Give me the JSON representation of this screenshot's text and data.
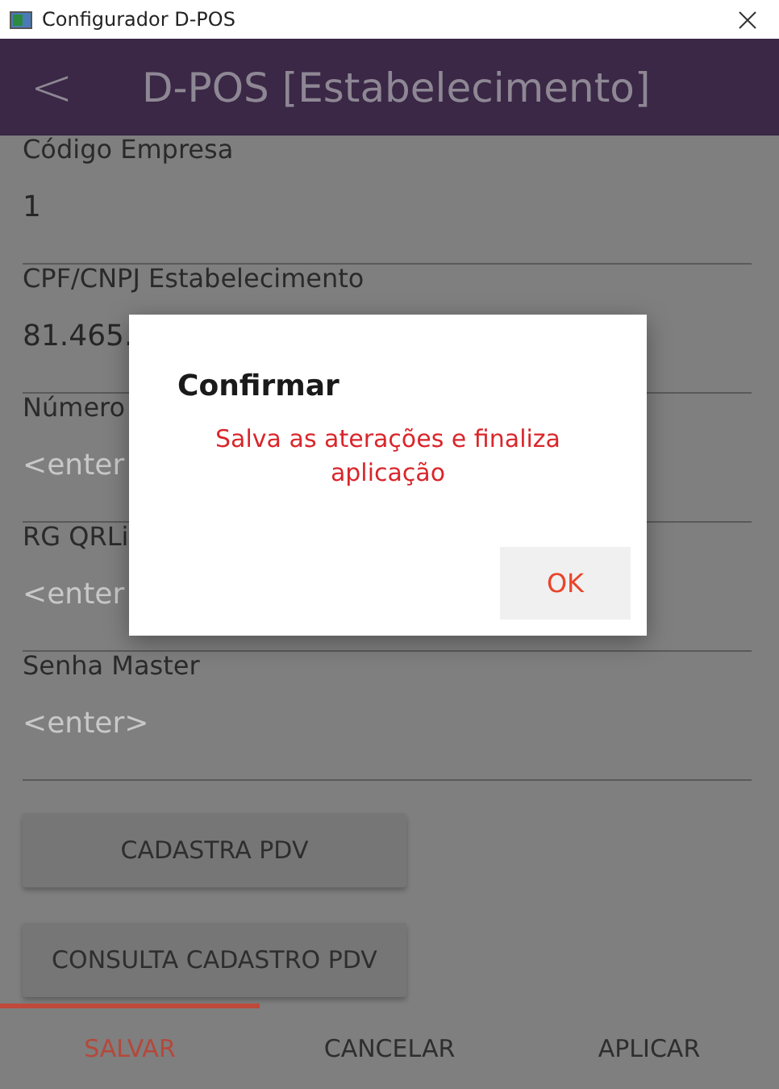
{
  "window": {
    "title": "Configurador D-POS"
  },
  "header": {
    "back": "<",
    "title": "D-POS [Estabelecimento]"
  },
  "fields": [
    {
      "label": "Código Empresa",
      "value": "1"
    },
    {
      "label": "CPF/CNPJ Estabelecimento",
      "value": "81.465."
    },
    {
      "label": "Número",
      "placeholder": "<enter"
    },
    {
      "label": "RG QRLi",
      "placeholder": "<enter"
    },
    {
      "label": "Senha Master",
      "placeholder": "<enter>"
    }
  ],
  "buttons": [
    "CADASTRA PDV",
    "CONSULTA CADASTRO PDV"
  ],
  "tabs": [
    {
      "label": "SALVAR",
      "selected": true
    },
    {
      "label": "CANCELAR",
      "selected": false
    },
    {
      "label": "APLICAR",
      "selected": false
    }
  ],
  "dialog": {
    "title": "Confirmar",
    "message": "Salva as aterações e finaliza aplicação",
    "button": "OK"
  }
}
